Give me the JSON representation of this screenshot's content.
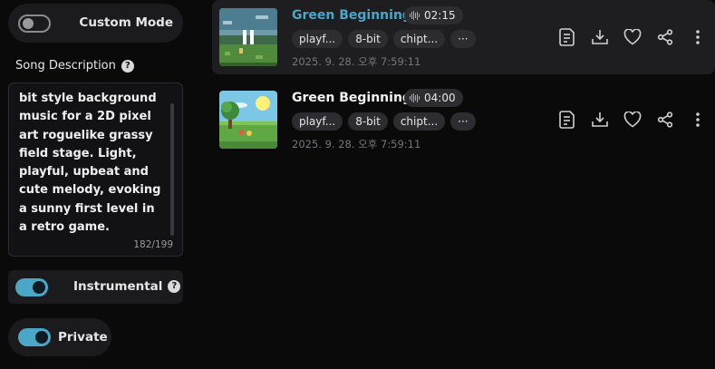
{
  "custom_mode": {
    "label": "Custom Mode",
    "enabled": false
  },
  "description": {
    "title": "Song Description",
    "text": "bit style background music for a 2D pixel art roguelike grassy field stage. Light, playful, upbeat and cute melody, evoking a sunny first level in a retro game.",
    "counter": "182/199"
  },
  "instrumental": {
    "label": "Instrumental",
    "enabled": true
  },
  "private": {
    "label": "Private",
    "enabled": true
  },
  "songs": [
    {
      "title": "Green Beginnings",
      "duration": "02:15",
      "tags": [
        "playf...",
        "8-bit",
        "chipt...",
        "···"
      ],
      "date": "2025. 9. 28. 오후 7:59:11",
      "playing": true
    },
    {
      "title": "Green Beginnings",
      "duration": "04:00",
      "tags": [
        "playf...",
        "8-bit",
        "chipt...",
        "···"
      ],
      "date": "2025. 9. 28. 오후 7:59:11",
      "playing": false
    }
  ],
  "icons": {
    "help": "?",
    "action_icons": [
      "lyrics-icon",
      "download-icon",
      "heart-icon",
      "share-icon",
      "more-icon"
    ]
  },
  "colors": {
    "accent": "#4aa7c7",
    "background": "#0a0a0b",
    "panel": "#1b1b1e"
  }
}
